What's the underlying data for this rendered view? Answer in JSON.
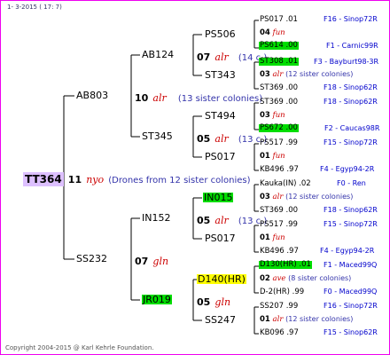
{
  "header": "1- 3-2015 ( 17: 7)",
  "copyright": "Copyright 2004-2015 @ Karl Kehrle Foundation.",
  "queen": {
    "id": "TT364",
    "num": "11",
    "race": "nyo",
    "note": "(Drones from 12 sister colonies)"
  },
  "g1": [
    {
      "id": "AB803",
      "num": "10",
      "race": "alr",
      "note": "(13 sister colonies)"
    },
    {
      "id": "SS232",
      "num": "07",
      "race": "gln",
      "note": ""
    }
  ],
  "g2": [
    {
      "id": "AB124",
      "num": "07",
      "race": "alr",
      "note": "(14 c.)"
    },
    {
      "id": "ST345",
      "num": "05",
      "race": "alr",
      "note": "(13 c.)"
    },
    {
      "id": "IN152",
      "num": "05",
      "race": "alr",
      "note": "(13 c.)"
    },
    {
      "id": "JR019",
      "num": "05",
      "race": "gln",
      "note": ""
    }
  ],
  "g3": [
    {
      "id": "PS506"
    },
    {
      "id": "ST343"
    },
    {
      "id": "ST494"
    },
    {
      "id": "PS017"
    },
    {
      "id": "IN015"
    },
    {
      "id": "PS017"
    },
    {
      "id": "D140(HR)"
    },
    {
      "id": "SS247"
    }
  ],
  "leaves": [
    {
      "text": "PS017 .01",
      "code": "F16 - Sinop72R"
    },
    {
      "text": "04",
      "race": "fun"
    },
    {
      "text": "PS614 .00",
      "code": "F1 - Carnic99R"
    },
    {
      "text": "ST308 .01",
      "code": "F3 - Bayburt98-3R"
    },
    {
      "text": "03",
      "race": "alr",
      "note": "(12 sister colonies)"
    },
    {
      "text": "ST369 .00",
      "code": "F18 - Sinop62R"
    },
    {
      "text": "ST369 .00",
      "code": "F18 - Sinop62R"
    },
    {
      "text": "03",
      "race": "fun"
    },
    {
      "text": "PS672 .00",
      "code": "F2 - Caucas98R"
    },
    {
      "text": "PS517 .99",
      "code": "F15 - Sinop72R"
    },
    {
      "text": "01",
      "race": "fun"
    },
    {
      "text": "KB496 .97",
      "code": "F4 - Egyp94-2R"
    },
    {
      "text": "Kauka(IN) .02",
      "code": "F0 - Ren"
    },
    {
      "text": "03",
      "race": "alr",
      "note": "(12 sister colonies)"
    },
    {
      "text": "ST369 .00",
      "code": "F18 - Sinop62R"
    },
    {
      "text": "PS517 .99",
      "code": "F15 - Sinop72R"
    },
    {
      "text": "01",
      "race": "fun"
    },
    {
      "text": "KB496 .97",
      "code": "F4 - Egyp94-2R"
    },
    {
      "text": "D130(HR) .01",
      "code": "F1 - Maced99Q"
    },
    {
      "text": "02",
      "race": "ave",
      "note": "(8 sister colonies)"
    },
    {
      "text": "D-2(HR) .99",
      "code": "F0 - Maced99Q"
    },
    {
      "text": "SS207 .99",
      "code": "F16 - Sinop72R"
    },
    {
      "text": "01",
      "race": "alr",
      "note": "(12 sister colonies)"
    },
    {
      "text": "KB096 .97",
      "code": "F15 - Sinop62R"
    }
  ],
  "highlight_colors": {
    "root": "#ddc0ff",
    "green": "#00dd00",
    "yellow": "#ffff00",
    "border": "#ee00ee"
  }
}
